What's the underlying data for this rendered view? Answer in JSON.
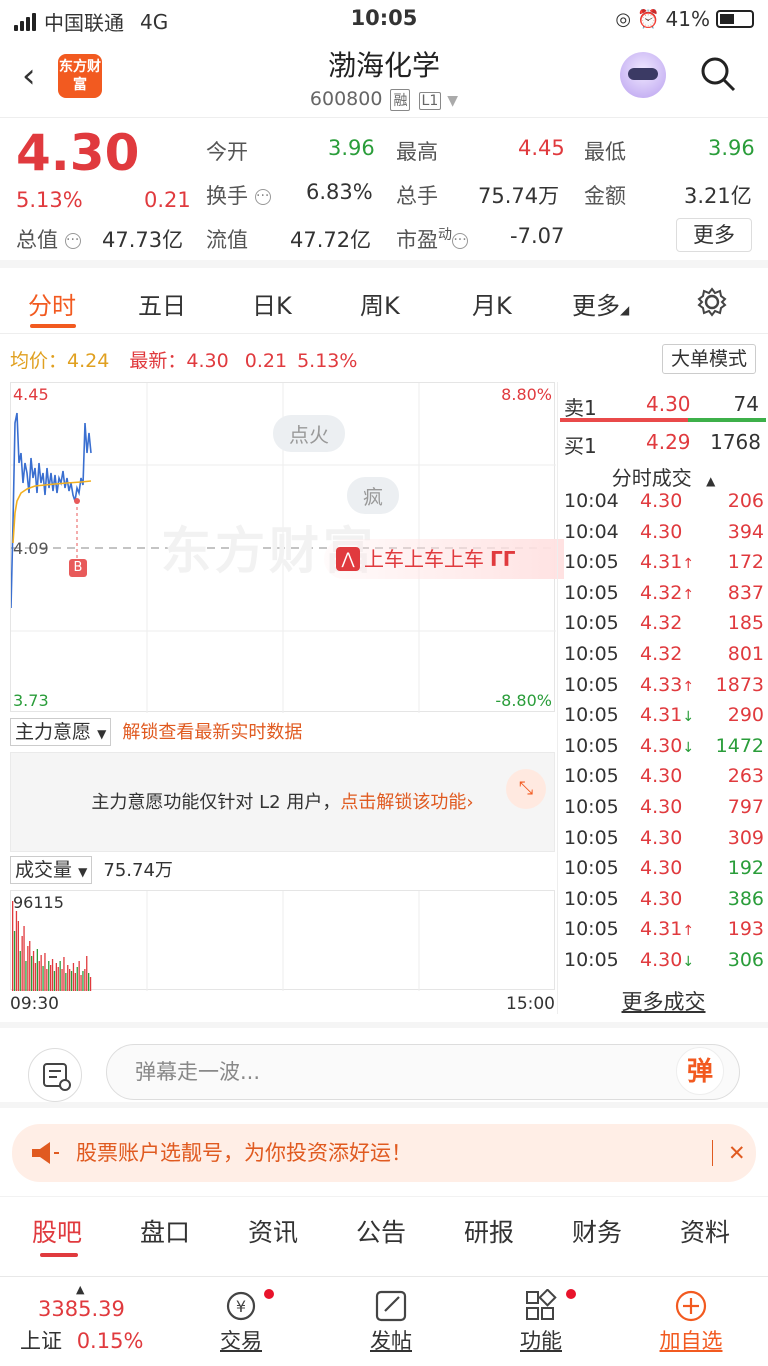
{
  "status_bar": {
    "carrier": "中国联通",
    "network": "4G",
    "time": "10:05",
    "battery": "41%"
  },
  "header": {
    "logo_text": "东方财富",
    "stock_name": "渤海化学",
    "stock_code": "600800",
    "tag_rong": "融",
    "tag_level": "L1"
  },
  "quote": {
    "price": "4.30",
    "change_pct": "5.13%",
    "change": "0.21",
    "open_label": "今开",
    "open": "3.96",
    "high_label": "最高",
    "high": "4.45",
    "low_label": "最低",
    "low": "3.96",
    "turnover_label": "换手",
    "turnover": "6.83%",
    "volume_label": "总手",
    "volume": "75.74万",
    "amount_label": "金额",
    "amount": "3.21亿",
    "mktcap_label": "总值",
    "mktcap": "47.73亿",
    "float_label": "流值",
    "float": "47.72亿",
    "pe_label": "市盈",
    "pe_sup": "动",
    "pe": "-7.07",
    "more_label": "更多"
  },
  "tabs": [
    "分时",
    "五日",
    "日K",
    "周K",
    "月K",
    "更多"
  ],
  "intraday": {
    "avg_label": "均价：",
    "avg": "4.24",
    "latest_label": "最新：",
    "latest": "4.30",
    "latest_change": "0.21",
    "latest_pct": "5.13%",
    "big_order_mode": "大单模式",
    "y_top": "4.45",
    "y_mid": "4.09",
    "y_bottom": "3.73",
    "pct_top": "8.80%",
    "pct_bottom": "-8.80%",
    "watermark": "东方财富",
    "bubble1": "点火",
    "bubble2": "疯",
    "danmu": "上车上车上车",
    "buy_marker": "B"
  },
  "zhuli": {
    "dropdown": "主力意愿",
    "unlock": "解锁查看最新实时数据",
    "notice_text": "主力意愿功能仅针对 L2 用户，",
    "notice_link": "点击解锁该功能"
  },
  "volume": {
    "dropdown": "成交量",
    "value": "75.74万",
    "max": "96115",
    "t_start": "09:30",
    "t_end": "15:00"
  },
  "order_book": {
    "sell1_label": "卖1",
    "sell1_price": "4.30",
    "sell1_vol": "74",
    "buy1_label": "买1",
    "buy1_price": "4.29",
    "buy1_vol": "1768",
    "trades_header": "分时成交",
    "trades": [
      {
        "t": "10:04",
        "p": "4.30",
        "a": "",
        "v": "206",
        "vc": "red"
      },
      {
        "t": "10:04",
        "p": "4.30",
        "a": "",
        "v": "394",
        "vc": "red"
      },
      {
        "t": "10:05",
        "p": "4.31",
        "a": "↑",
        "v": "172",
        "vc": "red"
      },
      {
        "t": "10:05",
        "p": "4.32",
        "a": "↑",
        "v": "837",
        "vc": "red"
      },
      {
        "t": "10:05",
        "p": "4.32",
        "a": "",
        "v": "185",
        "vc": "red"
      },
      {
        "t": "10:05",
        "p": "4.32",
        "a": "",
        "v": "801",
        "vc": "red"
      },
      {
        "t": "10:05",
        "p": "4.33",
        "a": "↑",
        "v": "1873",
        "vc": "red"
      },
      {
        "t": "10:05",
        "p": "4.31",
        "a": "↓",
        "v": "290",
        "vc": "red"
      },
      {
        "t": "10:05",
        "p": "4.30",
        "a": "↓",
        "v": "1472",
        "vc": "green"
      },
      {
        "t": "10:05",
        "p": "4.30",
        "a": "",
        "v": "263",
        "vc": "red"
      },
      {
        "t": "10:05",
        "p": "4.30",
        "a": "",
        "v": "797",
        "vc": "red"
      },
      {
        "t": "10:05",
        "p": "4.30",
        "a": "",
        "v": "309",
        "vc": "red"
      },
      {
        "t": "10:05",
        "p": "4.30",
        "a": "",
        "v": "192",
        "vc": "green"
      },
      {
        "t": "10:05",
        "p": "4.30",
        "a": "",
        "v": "386",
        "vc": "green"
      },
      {
        "t": "10:05",
        "p": "4.31",
        "a": "↑",
        "v": "193",
        "vc": "red"
      },
      {
        "t": "10:05",
        "p": "4.30",
        "a": "↓",
        "v": "306",
        "vc": "green"
      }
    ],
    "more_trades": "更多成交"
  },
  "comment_bar": {
    "placeholder": "弹幕走一波...",
    "danmu_btn": "弹"
  },
  "notice": {
    "text": "股票账户选靓号，为你投资添好运！",
    "close": "✕"
  },
  "bottom_tabs": [
    "股吧",
    "盘口",
    "资讯",
    "公告",
    "研报",
    "财务",
    "资料"
  ],
  "bottom_bar": {
    "index_value": "3385.39",
    "index_name": "上证",
    "index_pct": "0.15%",
    "trade": "交易",
    "post": "发帖",
    "function": "功能",
    "add_watch": "加自选"
  },
  "colors": {
    "up": "#e03a3e",
    "down": "#2a9d3a",
    "accent": "#f25a20"
  }
}
